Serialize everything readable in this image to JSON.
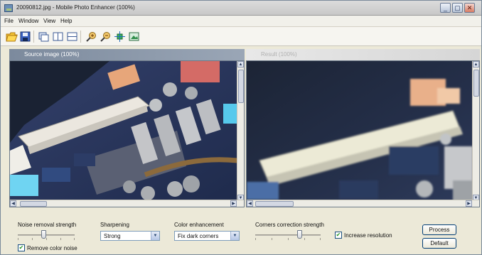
{
  "window": {
    "title": "20090812.jpg - Mobile Photo Enhancer (100%)"
  },
  "window_controls": {
    "minimize": "_",
    "restore": "▢",
    "close": "✕"
  },
  "menu": [
    "File",
    "Window",
    "View",
    "Help"
  ],
  "toolbar": [
    "open-folder-icon",
    "save-icon",
    "tile-icon",
    "split-vertical-icon",
    "split-horizontal-icon",
    "zoom-in-icon",
    "zoom-out-icon",
    "fit-window-icon",
    "actual-size-icon"
  ],
  "panes": {
    "source_title": "Source image (100%)",
    "result_title": "Result (100%)"
  },
  "controls": {
    "noise_removal": {
      "label": "Noise removal strength",
      "value_fraction": 0.45
    },
    "remove_color_noise": {
      "label": "Remove color noise",
      "checked": true
    },
    "sharpening": {
      "label": "Sharpening",
      "value": "Strong"
    },
    "color_enhancement": {
      "label": "Color enhancement",
      "value": "Fix dark corners"
    },
    "corners_correction": {
      "label": "Corners correction strength",
      "value_fraction": 0.7
    },
    "increase_resolution": {
      "label": "Increase resolution",
      "checked": true
    },
    "process_button": "Process",
    "default_button": "Default"
  },
  "colors": {
    "background": "#b9d05d",
    "accent": "#7c8a9d",
    "photo_board": "#26324f"
  }
}
